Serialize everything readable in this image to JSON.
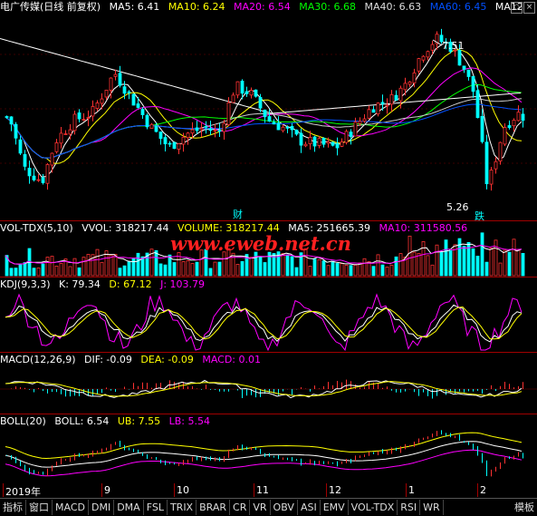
{
  "main": {
    "name": "电广传媒(日线 前复权)",
    "ma": [
      {
        "label": "MA5: 6.41",
        "color": "#ffffff"
      },
      {
        "label": "MA10: 6.24",
        "color": "#ffff00"
      },
      {
        "label": "MA20: 6.54",
        "color": "#ff00ff"
      },
      {
        "label": "MA30: 6.68",
        "color": "#00ff00"
      },
      {
        "label": "MA40: 6.63",
        "color": "#dddddd"
      },
      {
        "label": "MA60: 6.45",
        "color": "#0050ff"
      },
      {
        "label": "MA12",
        "color": "#ffffff"
      }
    ],
    "high_label": "7.51",
    "low_label": "5.26",
    "cai_label": "财",
    "die_label": "跌"
  },
  "vol": {
    "name": "VOL-TDX(5,10)",
    "vvol": "VVOL: 318217.44",
    "volume": "VOLUME: 318217.44",
    "ma5": "MA5: 251665.39",
    "ma10": "MA10: 311580.56",
    "watermark": "www.eweb.net.cn"
  },
  "kdj": {
    "name": "KDJ(9,3,3)",
    "k": "K: 79.34",
    "d": "D: 67.12",
    "j": "J: 103.79"
  },
  "macd": {
    "name": "MACD(12,26,9)",
    "dif": "DIF: -0.09",
    "dea": "DEA: -0.09",
    "macd": "MACD: 0.01"
  },
  "boll": {
    "name": "BOLL(20)",
    "boll": "BOLL: 6.54",
    "ub": "UB: 7.55",
    "lb": "LB: 5.54"
  },
  "axis_labels": [
    "2019年",
    "9",
    "10",
    "11",
    "12",
    "1",
    "2"
  ],
  "tabs": [
    "指标",
    "窗口",
    "MACD",
    "DMI",
    "DMA",
    "FSL",
    "TRIX",
    "BRAR",
    "CR",
    "VR",
    "OBV",
    "ASI",
    "EMV",
    "VOL-TDX",
    "RSI",
    "WR",
    "模板"
  ],
  "ctrl_glyphs": [
    "◇",
    "×"
  ]
}
